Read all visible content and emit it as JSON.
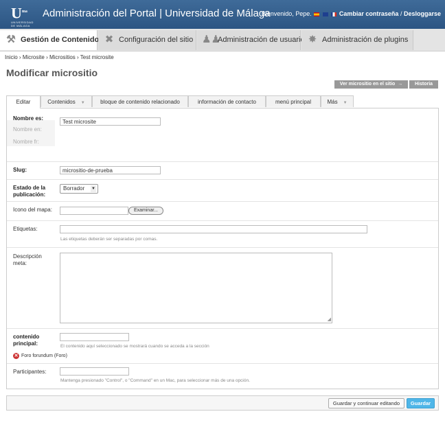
{
  "header": {
    "logo_mark": "U",
    "logo_sup": "ma",
    "logo_text": "UNIVERSIDAD DE MÁLAGA",
    "title": "Administración del Portal | Universidad de Málaga",
    "welcome": "Bienvenido, Pepe.",
    "change_password": "Cambiar contraseña",
    "separator": "/",
    "logout": "Desloggarse",
    "colors": {
      "bar": "#2f5a88"
    }
  },
  "nav": {
    "tabs": [
      {
        "label": "Gestión de Contenido",
        "icon": "tools-icon"
      },
      {
        "label": "Configuración del sitio",
        "icon": "wrench-icon"
      },
      {
        "label": "Administración de usuario",
        "icon": "users-icon"
      },
      {
        "label": "Administración de plugins",
        "icon": "puzzle-icon"
      }
    ]
  },
  "breadcrumb": {
    "items": [
      "Inicio",
      "Microsite",
      "Micrositios",
      "Test microsite"
    ],
    "sep": "›"
  },
  "page": {
    "title": "Modificar micrositio",
    "view_on_site": "Ver micrositio en el sitio",
    "arrow": "→",
    "history": "Historia"
  },
  "form_tabs": [
    {
      "label": "Editar",
      "dropdown": false
    },
    {
      "label": "Contenidos",
      "dropdown": true
    },
    {
      "label": "bloque de contenido relacionado",
      "dropdown": false
    },
    {
      "label": "información de contacto",
      "dropdown": false
    },
    {
      "label": "menú principal",
      "dropdown": false
    },
    {
      "label": "Más",
      "dropdown": true
    }
  ],
  "fields": {
    "name": {
      "label": "Nombre es:",
      "value": "Test microsite"
    },
    "name_en": {
      "label": "Nombre en:"
    },
    "name_fr": {
      "label": "Nombre fr:"
    },
    "slug": {
      "label": "Slug:",
      "value": "micrositio-de-prueba"
    },
    "status": {
      "label": "Estado de la publicación:",
      "value": "Borrador"
    },
    "map_icon": {
      "label": "Icono del mapa:",
      "button": "Examinar..."
    },
    "tags": {
      "label": "Etiquetas:",
      "help": "Las etiquetas deberán ser separadas por comas."
    },
    "meta": {
      "label": "Descripción meta:"
    },
    "main_content": {
      "label": "contenido principal:",
      "help": "El contenido aquí seleccionado se mostrará cuando se acceda a la sección",
      "error": "Foro forundum (Foro)"
    },
    "participants": {
      "label": "Participantes:",
      "help": "Mantenga presionado \"Control\", o \"Command\" en un Mac, para seleccionar más de una opción."
    }
  },
  "submit": {
    "save_continue": "Guardar y continuar editando",
    "save": "Guardar"
  }
}
